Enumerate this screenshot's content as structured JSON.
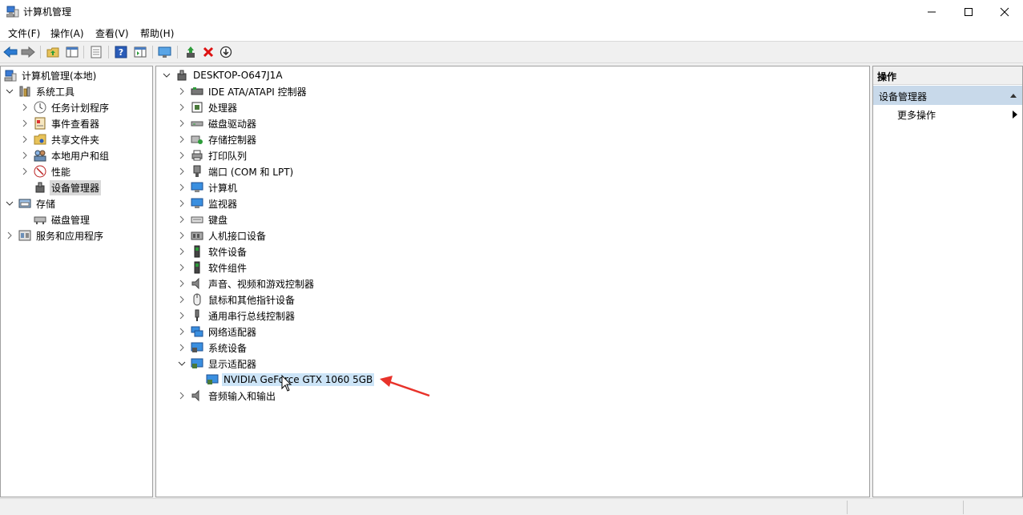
{
  "window": {
    "title": "计算机管理"
  },
  "menu": [
    {
      "label": "文件(F)"
    },
    {
      "label": "操作(A)"
    },
    {
      "label": "查看(V)"
    },
    {
      "label": "帮助(H)"
    }
  ],
  "left_tree": {
    "root": "计算机管理(本地)",
    "system_tools": "系统工具",
    "items": [
      "任务计划程序",
      "事件查看器",
      "共享文件夹",
      "本地用户和组",
      "性能",
      "设备管理器"
    ],
    "storage": "存储",
    "storage_items": [
      "磁盘管理"
    ],
    "services": "服务和应用程序"
  },
  "device_tree": {
    "root": "DESKTOP-O647J1A",
    "categories": [
      "IDE ATA/ATAPI 控制器",
      "处理器",
      "磁盘驱动器",
      "存储控制器",
      "打印队列",
      "端口 (COM 和 LPT)",
      "计算机",
      "监视器",
      "键盘",
      "人机接口设备",
      "软件设备",
      "软件组件",
      "声音、视频和游戏控制器",
      "鼠标和其他指针设备",
      "通用串行总线控制器",
      "网络适配器",
      "系统设备",
      "显示适配器"
    ],
    "display_child": "NVIDIA GeForce GTX 1060 5GB",
    "last": "音频输入和输出"
  },
  "actions": {
    "header": "操作",
    "section": "设备管理器",
    "more": "更多操作"
  },
  "colors": {
    "accent_selection": "#cce4f7",
    "arrow": "#e8322a",
    "section_bg": "#c8d9ea"
  }
}
